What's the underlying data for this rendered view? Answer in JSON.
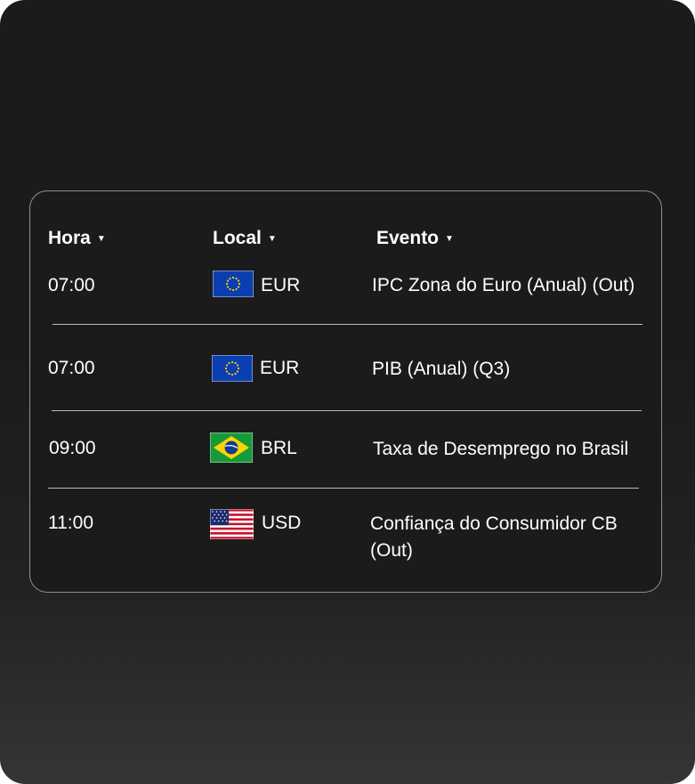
{
  "columns": {
    "time": "Hora",
    "local": "Local",
    "event": "Evento"
  },
  "rows": [
    {
      "time": "07:00",
      "currency": "EUR",
      "flag": "eu-flag-icon",
      "event": "IPC Zona do Euro (Anual) (Out)"
    },
    {
      "time": "07:00",
      "currency": "EUR",
      "flag": "eu-flag-icon",
      "event": "PIB (Anual) (Q3)"
    },
    {
      "time": "09:00",
      "currency": "BRL",
      "flag": "brazil-flag-icon",
      "event": "Taxa de Desemprego no Brasil"
    },
    {
      "time": "11:00",
      "currency": "USD",
      "flag": "us-flag-icon",
      "event": "Confiança do Consumidor CB (Out)"
    }
  ],
  "colors": {
    "background": "#1b1b1b",
    "border": "#8f8f8f",
    "text": "#ffffff"
  }
}
